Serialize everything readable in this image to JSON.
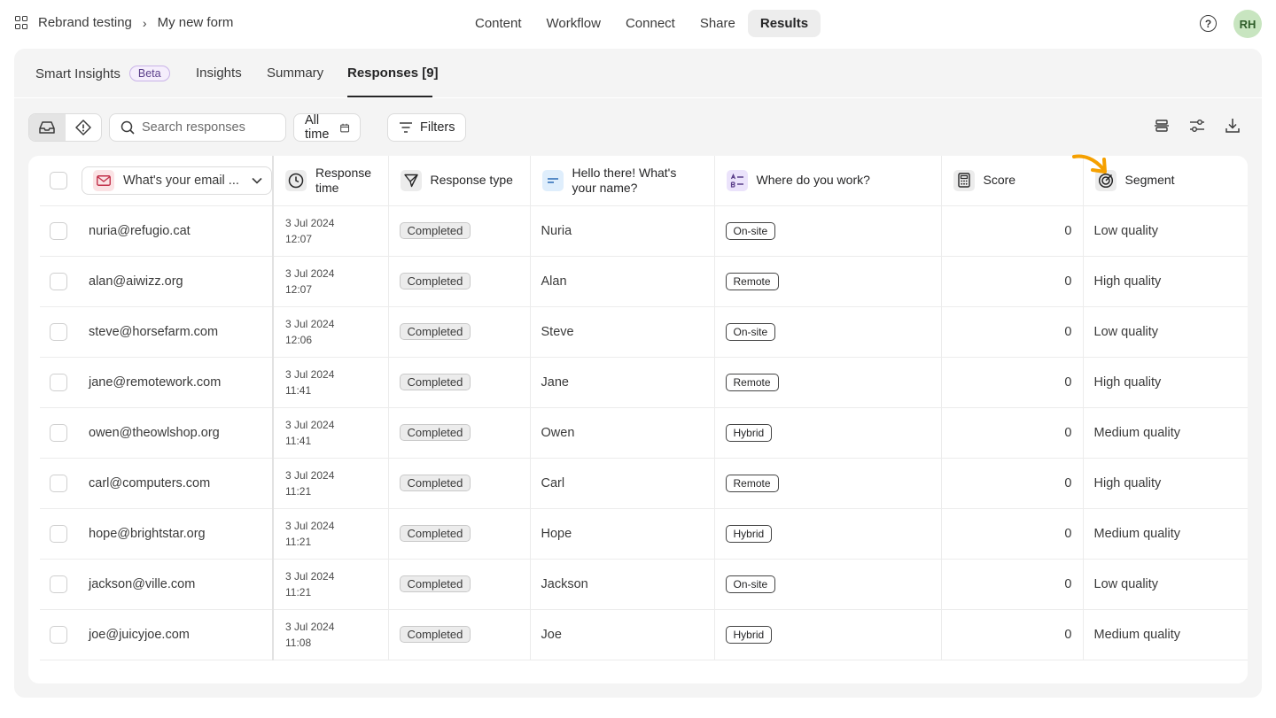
{
  "breadcrumb": {
    "workspace": "Rebrand testing",
    "separator": "›",
    "form": "My new form"
  },
  "topnav": [
    {
      "label": "Content",
      "active": false
    },
    {
      "label": "Workflow",
      "active": false
    },
    {
      "label": "Connect",
      "active": false
    },
    {
      "label": "Share",
      "active": false
    },
    {
      "label": "Results",
      "active": true
    }
  ],
  "help_label": "?",
  "avatar_initials": "RH",
  "tabs": {
    "smart_insights": "Smart Insights",
    "beta": "Beta",
    "insights": "Insights",
    "summary": "Summary",
    "responses": "Responses [9]"
  },
  "toolbar": {
    "search_placeholder": "Search responses",
    "time_filter": "All time",
    "filters": "Filters"
  },
  "columns": {
    "email": "What's your email ...",
    "response_time_1": "Response",
    "response_time_2": "time",
    "response_type": "Response type",
    "name_1": "Hello there! What's",
    "name_2": "your name?",
    "work": "Where do you work?",
    "score": "Score",
    "segment": "Segment"
  },
  "colors": {
    "accent_arrow": "#f5a000",
    "avatar_bg": "#c8e5c0",
    "beta_border": "#c9b3e8"
  },
  "rows": [
    {
      "email": "nuria@refugio.cat",
      "date": "3 Jul 2024",
      "time": "12:07",
      "type": "Completed",
      "name": "Nuria",
      "work": "On-site",
      "score": "0",
      "segment": "Low quality"
    },
    {
      "email": "alan@aiwizz.org",
      "date": "3 Jul 2024",
      "time": "12:07",
      "type": "Completed",
      "name": "Alan",
      "work": "Remote",
      "score": "0",
      "segment": "High quality"
    },
    {
      "email": "steve@horsefarm.com",
      "date": "3 Jul 2024",
      "time": "12:06",
      "type": "Completed",
      "name": "Steve",
      "work": "On-site",
      "score": "0",
      "segment": "Low quality"
    },
    {
      "email": "jane@remotework.com",
      "date": "3 Jul 2024",
      "time": "11:41",
      "type": "Completed",
      "name": "Jane",
      "work": "Remote",
      "score": "0",
      "segment": "High quality"
    },
    {
      "email": "owen@theowlshop.org",
      "date": "3 Jul 2024",
      "time": "11:41",
      "type": "Completed",
      "name": "Owen",
      "work": "Hybrid",
      "score": "0",
      "segment": "Medium quality"
    },
    {
      "email": "carl@computers.com",
      "date": "3 Jul 2024",
      "time": "11:21",
      "type": "Completed",
      "name": "Carl",
      "work": "Remote",
      "score": "0",
      "segment": "High quality"
    },
    {
      "email": "hope@brightstar.org",
      "date": "3 Jul 2024",
      "time": "11:21",
      "type": "Completed",
      "name": "Hope",
      "work": "Hybrid",
      "score": "0",
      "segment": "Medium quality"
    },
    {
      "email": "jackson@ville.com",
      "date": "3 Jul 2024",
      "time": "11:21",
      "type": "Completed",
      "name": "Jackson",
      "work": "On-site",
      "score": "0",
      "segment": "Low quality"
    },
    {
      "email": "joe@juicyjoe.com",
      "date": "3 Jul 2024",
      "time": "11:08",
      "type": "Completed",
      "name": "Joe",
      "work": "Hybrid",
      "score": "0",
      "segment": "Medium quality"
    }
  ]
}
